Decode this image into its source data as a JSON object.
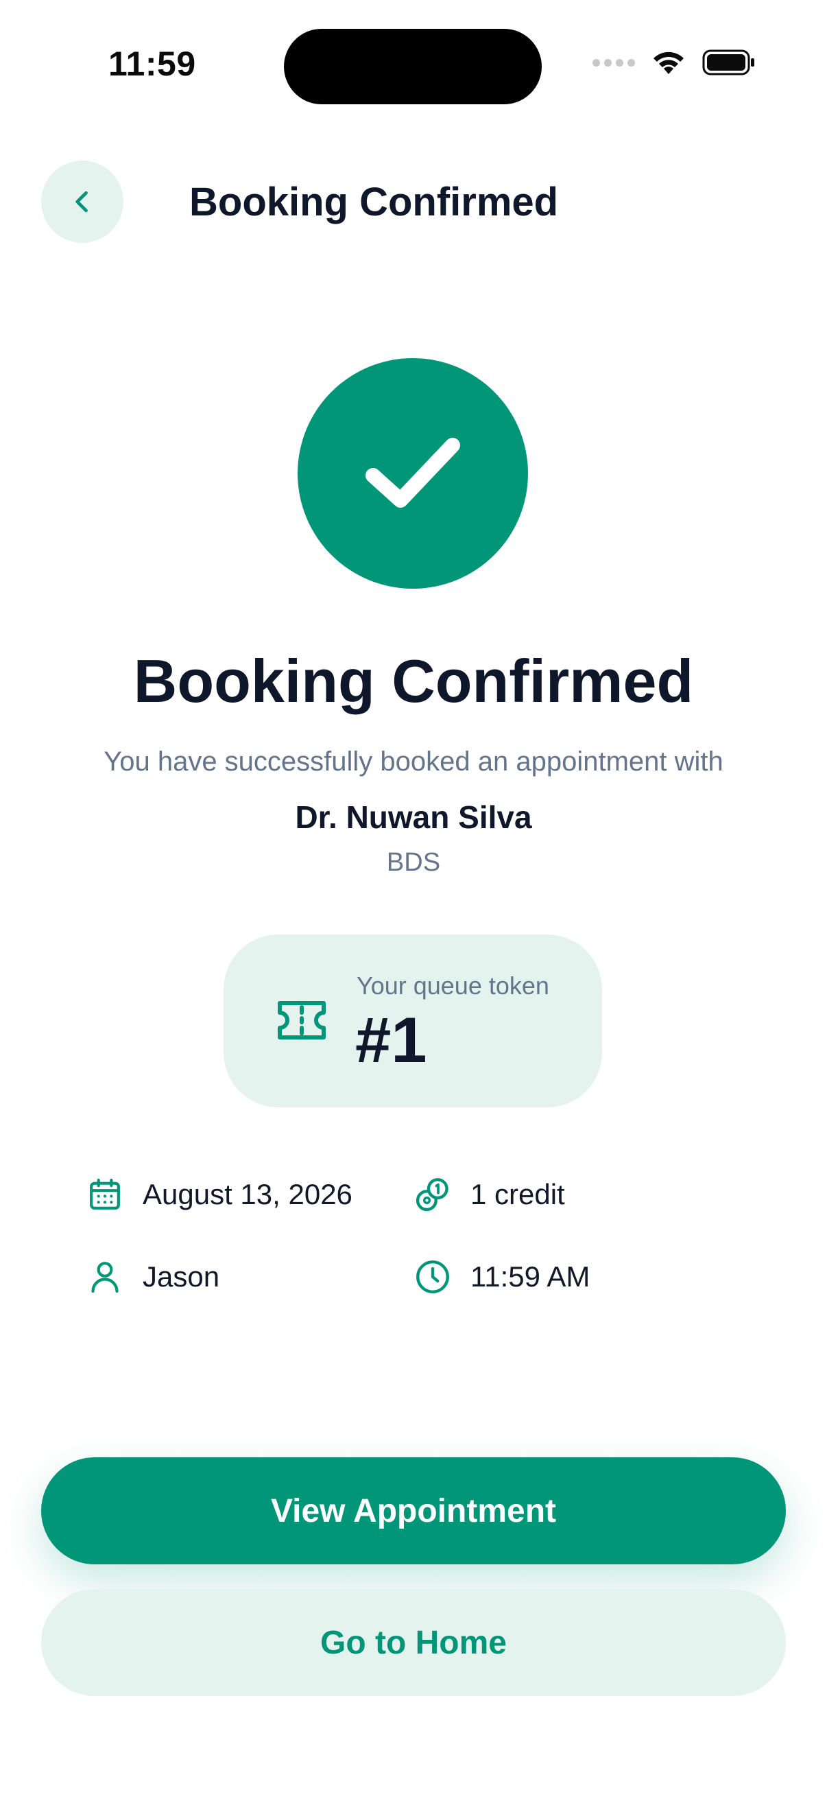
{
  "status_bar": {
    "time": "11:59"
  },
  "header": {
    "title": "Booking Confirmed"
  },
  "confirmation": {
    "title": "Booking Confirmed",
    "subtitle": "You have successfully booked an appointment with",
    "doctor_name": "Dr. Nuwan Silva",
    "doctor_degree": "BDS"
  },
  "token": {
    "label": "Your queue token",
    "value": "#1"
  },
  "details": {
    "date": "August 13, 2026",
    "credit": "1 credit",
    "patient": "Jason",
    "time": "11:59 AM"
  },
  "actions": {
    "primary_label": "View Appointment",
    "secondary_label": "Go to Home"
  },
  "colors": {
    "accent": "#009677",
    "accent_light": "#e5f3ef",
    "text_primary": "#0f172a",
    "text_secondary": "#64748b"
  },
  "icons": {
    "back": "chevron-left-icon",
    "success": "checkmark-icon",
    "token": "ticket-icon",
    "date": "calendar-icon",
    "credit": "coins-icon",
    "patient": "user-icon",
    "time": "clock-icon"
  }
}
